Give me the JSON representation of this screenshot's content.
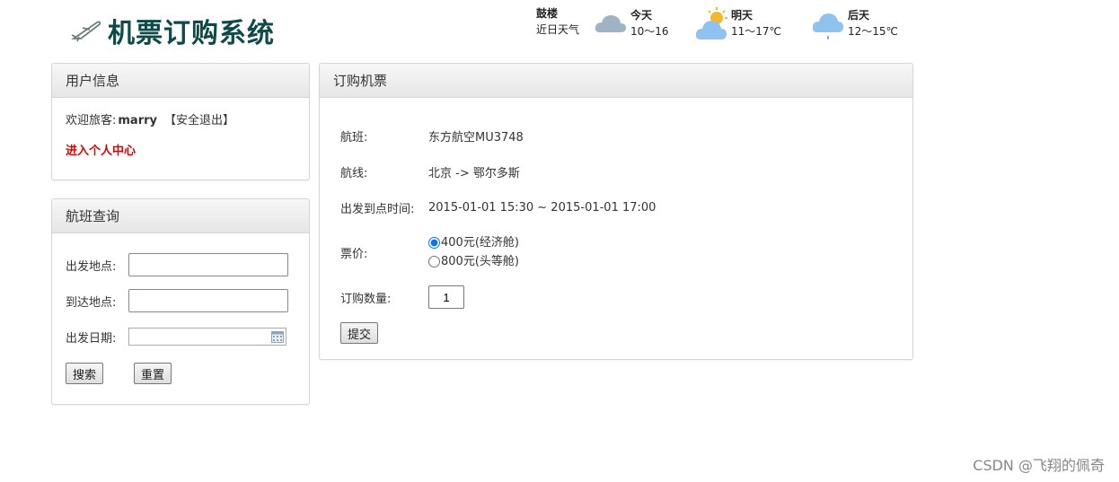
{
  "header": {
    "title": "机票订购系统",
    "logo_icon": "airplane-icon"
  },
  "weather": {
    "city": "鼓楼",
    "caption": "近日天气",
    "days": [
      {
        "label": "今天",
        "range": "10～16",
        "icon": "cloud-icon"
      },
      {
        "label": "明天",
        "range": "11～17℃",
        "icon": "partly-cloudy-icon"
      },
      {
        "label": "后天",
        "range": "12～15℃",
        "icon": "rain-cloud-icon"
      }
    ]
  },
  "user_panel": {
    "title": "用户信息",
    "welcome_prefix": "欢迎旅客:",
    "username": "marry",
    "logout": "【安全退出】",
    "center_link": "进入个人中心"
  },
  "search_panel": {
    "title": "航班查询",
    "depart_label": "出发地点:",
    "arrive_label": "到达地点:",
    "date_label": "出发日期:",
    "depart_value": "",
    "arrive_value": "",
    "search_button": "搜索",
    "reset_button": "重置"
  },
  "order_panel": {
    "title": "订购机票",
    "flight_label": "航班:",
    "flight_value": "东方航空MU3748",
    "route_label": "航线:",
    "route_value": "北京 -> 鄂尔多斯",
    "time_label": "出发到点时间:",
    "time_value": "2015-01-01 15:30 ~ 2015-01-01 17:00",
    "price_label": "票价:",
    "price_options": [
      "400元(经济舱)",
      "800元(头等舱)"
    ],
    "price_selected": "400元(经济舱)",
    "qty_label": "订购数量:",
    "qty_value": "1",
    "submit_button": "提交"
  },
  "watermark": "CSDN @飞翔的佩奇"
}
